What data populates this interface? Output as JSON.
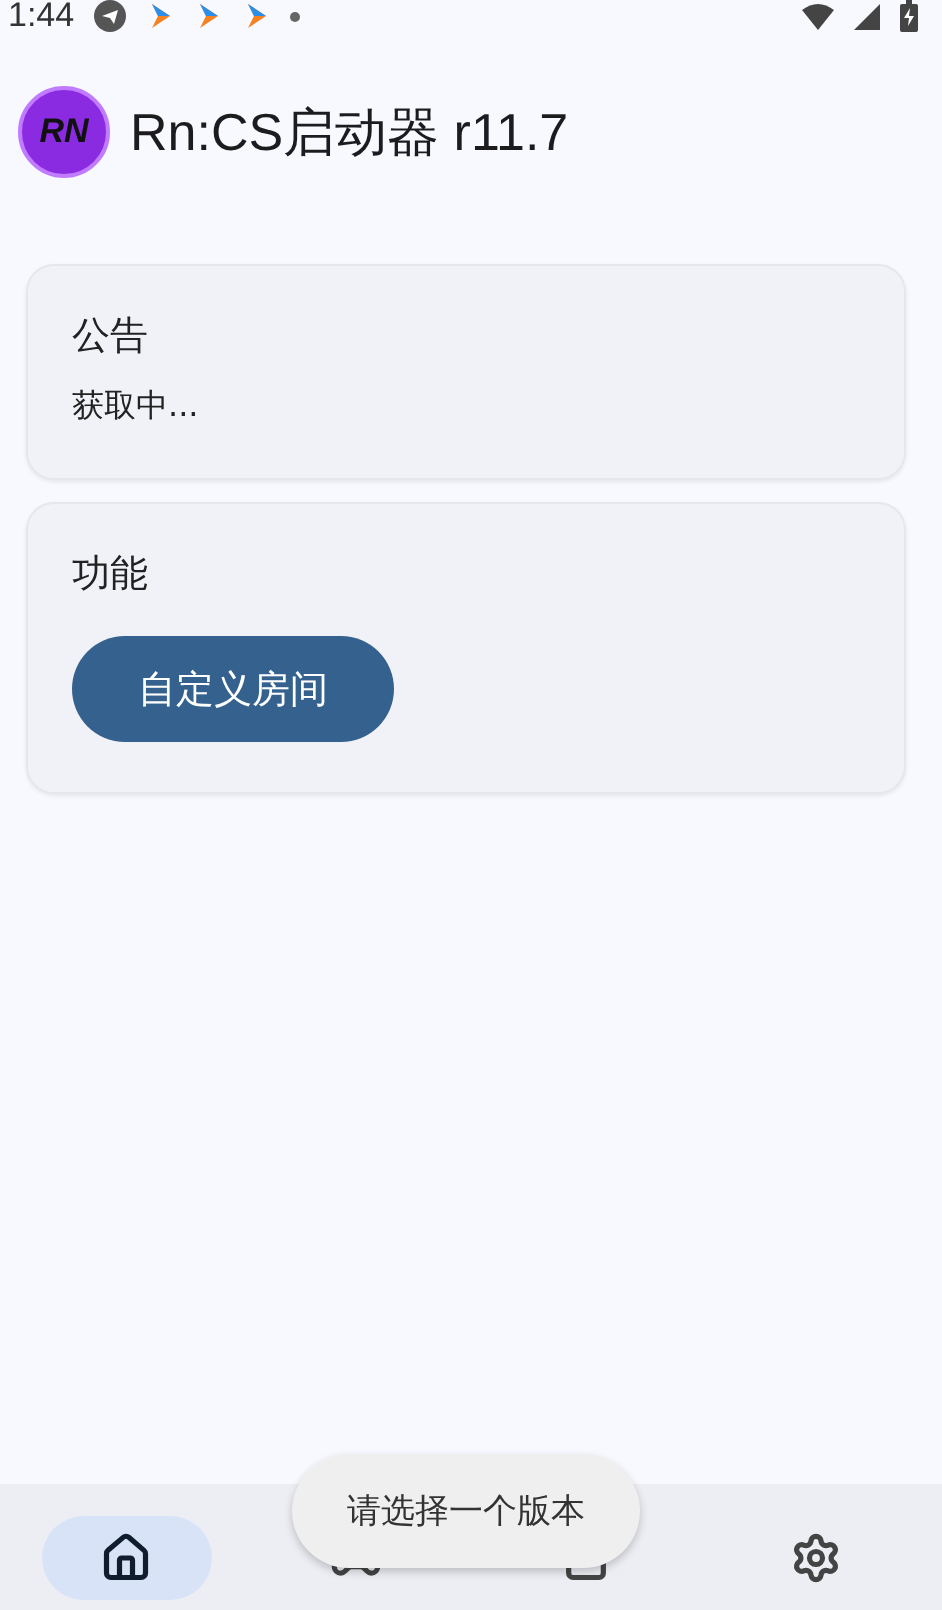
{
  "status_bar": {
    "time": "1:44"
  },
  "app_bar": {
    "logo_text": "RN",
    "title": "Rn:CS启动器 r11.7"
  },
  "cards": [
    {
      "title": "公告",
      "body": "获取中..."
    },
    {
      "title": "功能",
      "buttons": [
        "自定义房间"
      ]
    }
  ],
  "nav_items": [
    {
      "selected": true
    },
    {
      "selected": false
    },
    {
      "selected": false
    },
    {
      "selected": false
    }
  ],
  "toast": "请选择一个版本"
}
